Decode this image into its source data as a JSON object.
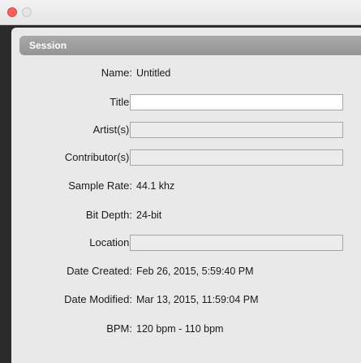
{
  "window": {
    "controls": [
      "close-button",
      "minimize-button"
    ]
  },
  "section": {
    "title": "Session"
  },
  "fields": {
    "name": {
      "label": "Name:",
      "value": "Untitled"
    },
    "title": {
      "label": "Title:",
      "value": ""
    },
    "artists": {
      "label": "Artist(s):",
      "value": ""
    },
    "contributors": {
      "label": "Contributor(s):",
      "value": ""
    },
    "sample_rate": {
      "label": "Sample Rate:",
      "value": "44.1 khz"
    },
    "bit_depth": {
      "label": "Bit Depth:",
      "value": "24-bit"
    },
    "location": {
      "label": "Location:",
      "value": ""
    },
    "date_created": {
      "label": "Date Created:",
      "value": "Feb 26, 2015, 5:59:40 PM"
    },
    "date_modified": {
      "label": "Date Modified:",
      "value": "Mar 13, 2015, 11:59:04 PM"
    },
    "bpm": {
      "label": "BPM:",
      "value": "120 bpm - 110 bpm"
    }
  }
}
